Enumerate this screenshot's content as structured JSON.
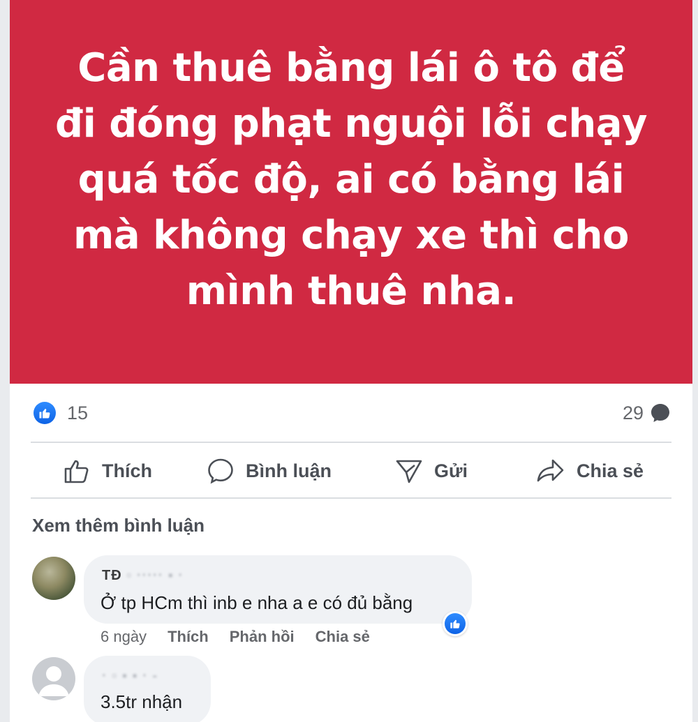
{
  "post": {
    "text": "Cần thuê bằng lái ô tô để đi đóng phạt nguội lỗi chạy quá tốc độ, ai có bằng lái mà không chạy xe thì cho mình thuê nha.",
    "background_color": "#d02942"
  },
  "stats": {
    "likes": "15",
    "comments": "29"
  },
  "actions": {
    "like": "Thích",
    "comment": "Bình luận",
    "send": "Gửi",
    "share": "Chia sẻ"
  },
  "more_comments": "Xem thêm bình luận",
  "comments": [
    {
      "author": "TĐ",
      "text": "Ở tp HCm thì inb e nha a e có đủ bằng",
      "time": "6 ngày",
      "like": "Thích",
      "reply": "Phản hồi",
      "share": "Chia sẻ"
    },
    {
      "author": "",
      "text": "3.5tr nhận"
    }
  ],
  "icons": {
    "like_badge": "thumbs-up-icon",
    "comment_count": "speech-bubble-icon",
    "like": "thumbs-up-outline-icon",
    "comment": "speech-bubble-outline-icon",
    "send": "send-icon",
    "share": "share-arrow-icon"
  },
  "colors": {
    "facebook_blue": "#1877f2",
    "text_secondary": "#65676b"
  }
}
